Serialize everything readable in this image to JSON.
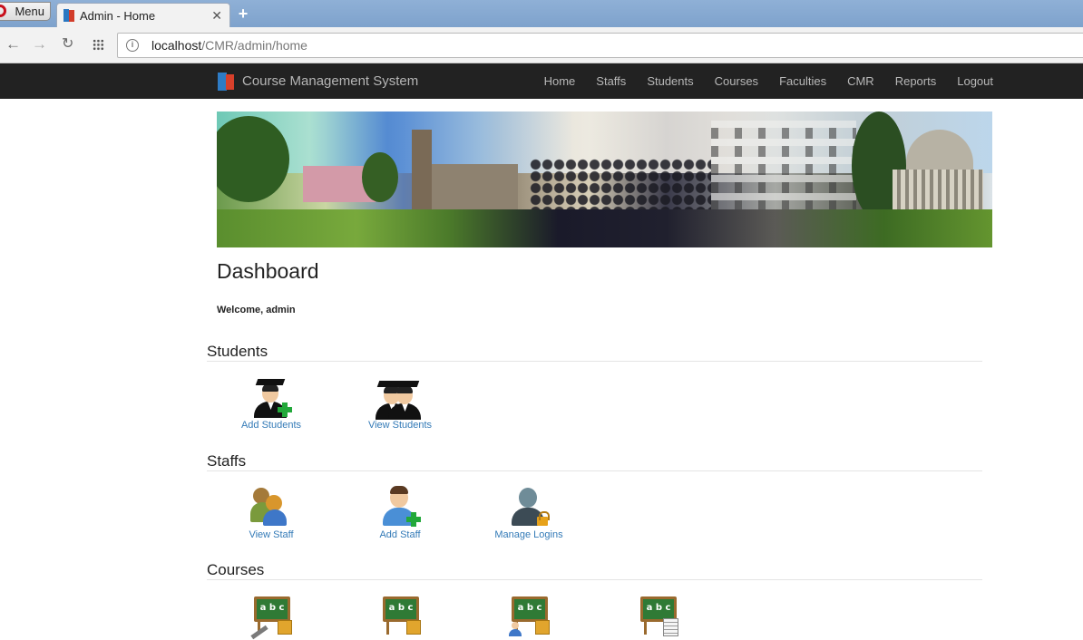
{
  "browser": {
    "menu_label": "Menu",
    "tab_title": "Admin - Home",
    "tab_close": "✕",
    "new_tab": "+",
    "url_host": "localhost",
    "url_path": "/CMR/admin/home"
  },
  "navbar": {
    "brand": "Course Management System",
    "links": [
      "Home",
      "Staffs",
      "Students",
      "Courses",
      "Faculties",
      "CMR",
      "Reports",
      "Logout"
    ]
  },
  "page": {
    "title": "Dashboard",
    "welcome": "Welcome, admin"
  },
  "sections": {
    "students": {
      "heading": "Students",
      "items": [
        {
          "label": "Add Students",
          "icon": "add-student-icon"
        },
        {
          "label": "View Students",
          "icon": "students-group-icon"
        }
      ]
    },
    "staffs": {
      "heading": "Staffs",
      "items": [
        {
          "label": "View Staff",
          "icon": "staff-group-icon"
        },
        {
          "label": "Add Staff",
          "icon": "add-staff-icon"
        },
        {
          "label": "Manage Logins",
          "icon": "staff-lock-icon"
        }
      ]
    },
    "courses": {
      "heading": "Courses",
      "items": [
        {
          "icon": "course-tools-icon",
          "board_text": "a b c"
        },
        {
          "icon": "course-box-icon",
          "board_text": "a b c"
        },
        {
          "icon": "course-user-icon",
          "board_text": "a b c"
        },
        {
          "icon": "course-report-icon",
          "board_text": "a b c"
        }
      ]
    }
  },
  "colors": {
    "navbar_bg": "#222222",
    "link": "#337ab7",
    "accent_green": "#22a83a"
  }
}
